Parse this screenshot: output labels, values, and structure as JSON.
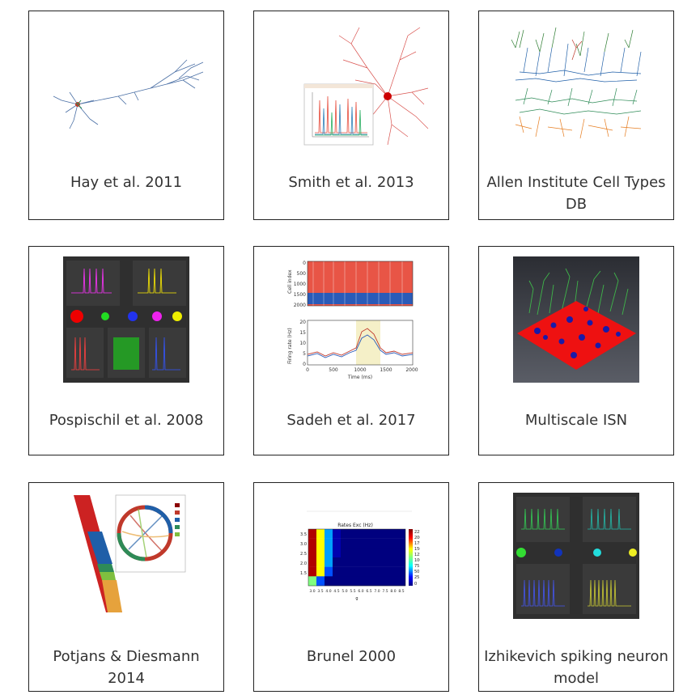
{
  "gallery": {
    "items": [
      {
        "title": "Hay et al. 2011"
      },
      {
        "title": "Smith et al. 2013"
      },
      {
        "title": "Allen Institute Cell Types DB"
      },
      {
        "title": "Pospischil et al. 2008"
      },
      {
        "title": "Sadeh et al. 2017"
      },
      {
        "title": "Multiscale ISN"
      },
      {
        "title": "Potjans & Diesmann 2014"
      },
      {
        "title": "Brunel 2000"
      },
      {
        "title": "Izhikevich spiking neuron model"
      }
    ],
    "sadeh_axes": {
      "raster_ylabel": "Cell index",
      "rate_ylabel": "Firing rate (Hz)",
      "xlabel": "Time (ms)",
      "raster_yticks": [
        "0",
        "500",
        "1000",
        "1500",
        "2000"
      ],
      "rate_yticks": [
        "20",
        "15",
        "10",
        "5",
        "0"
      ],
      "xticks": [
        "0",
        "500",
        "1000",
        "1500",
        "2000"
      ]
    },
    "brunel_axes": {
      "title": "Rates Exc (Hz)",
      "xlabel": "g",
      "yticks": [
        "1.5",
        "2.0",
        "2.5",
        "3.0",
        "3.5"
      ],
      "xticks": [
        "3.0",
        "3.5",
        "4.0",
        "4.5",
        "5.0",
        "5.5",
        "6.0",
        "6.5",
        "7.0",
        "7.5",
        "8.0",
        "8.5"
      ],
      "colorbar_ticks": [
        "225",
        "200",
        "175",
        "150",
        "125",
        "100",
        "75",
        "50",
        "25",
        "0"
      ]
    }
  }
}
